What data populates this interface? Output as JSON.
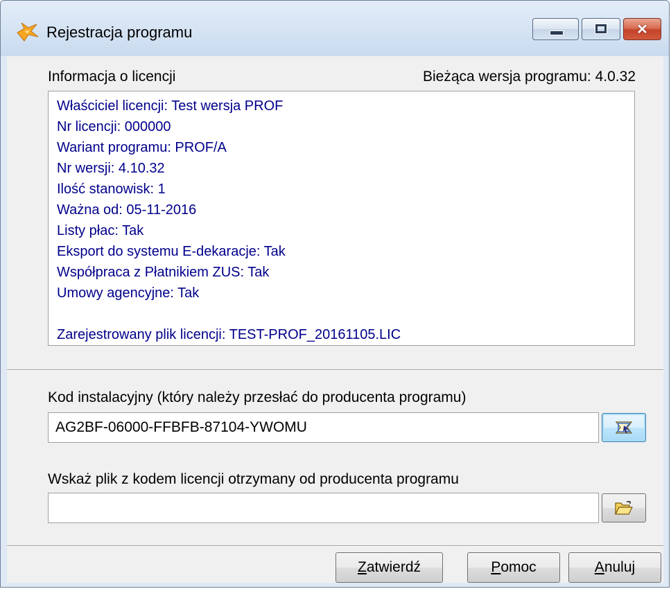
{
  "window": {
    "title": "Rejestracja programu",
    "controls": {
      "minimize": "minimize-icon",
      "maximize": "maximize-icon",
      "close": "close-icon"
    }
  },
  "license_info": {
    "label": "Informacja o licencji",
    "current_version": "Bieżąca wersja programu: 4.0.32",
    "lines": [
      "Właściciel licencji: Test wersja PROF",
      "Nr licencji: 000000",
      "Wariant programu: PROF/A",
      "Nr wersji: 4.10.32",
      "Ilość stanowisk: 1",
      "Ważna od: 05-11-2016",
      "Listy płac: Tak",
      "Eksport do systemu E-dekaracje: Tak",
      "Współpraca z Płatnikiem ZUS: Tak",
      "Umowy agencyjne: Tak"
    ],
    "registered_file": "Zarejestrowany plik licencji: TEST-PROF_20161105.LIC",
    "text_color": "#00008b"
  },
  "install_code": {
    "label": "Kod instalacyjny (który należy przesłać do producenta programu)",
    "value": "AG2BF-06000-FFBFB-87104-YWOMU",
    "button_icon": "copy-to-clipboard-icon"
  },
  "license_file": {
    "label": "Wskaż plik z kodem licencji otrzymany od producenta programu",
    "value": "",
    "button_icon": "open-folder-icon"
  },
  "buttons": {
    "ok": {
      "first": "Z",
      "rest": "atwierdź"
    },
    "help": {
      "first": "P",
      "rest": "omoc"
    },
    "cancel": {
      "first": "A",
      "rest": "nuluj"
    }
  }
}
